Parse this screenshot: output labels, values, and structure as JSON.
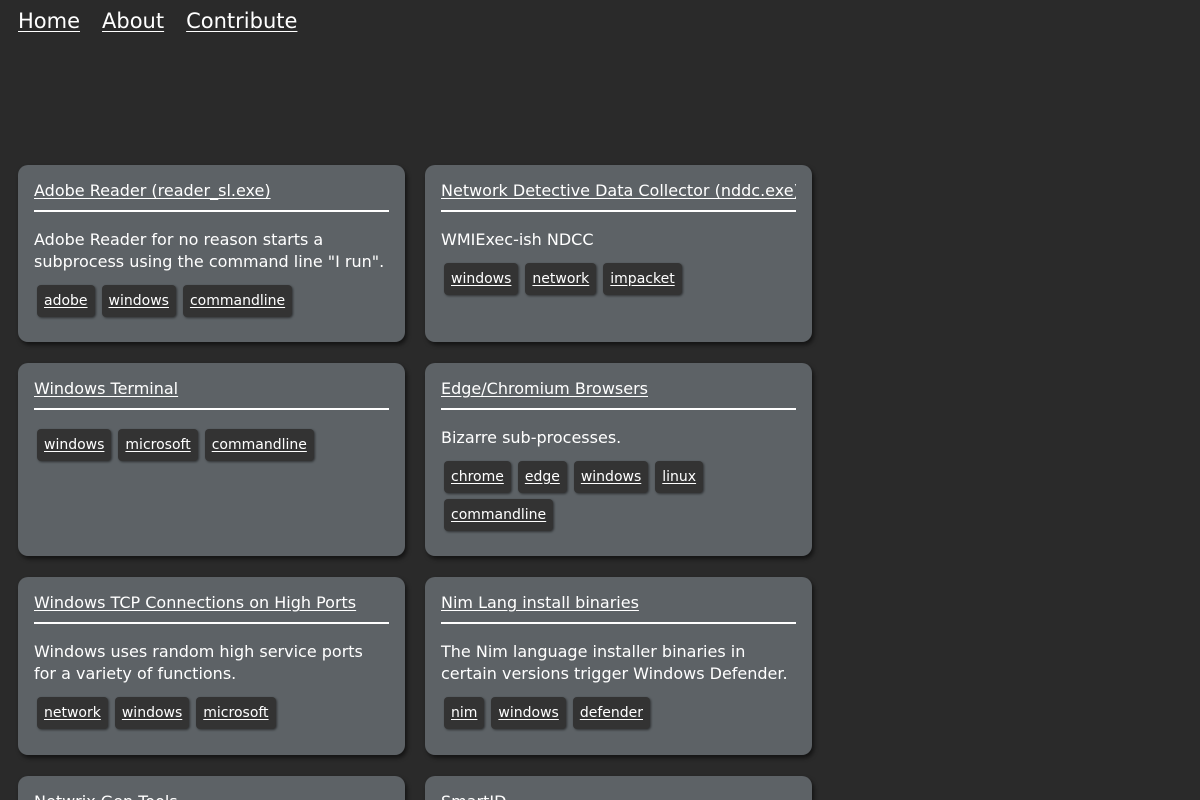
{
  "nav": {
    "home": "Home",
    "about": "About",
    "contribute": "Contribute"
  },
  "cards": [
    {
      "title": "Adobe Reader (reader_sl.exe)",
      "description": "Adobe Reader for no reason starts a subprocess using the command line \"I run\".",
      "tags": [
        "adobe",
        "windows",
        "commandline"
      ]
    },
    {
      "title": "Network Detective Data Collector (nddc.exe)",
      "description": "WMIExec-ish NDCC",
      "tags": [
        "windows",
        "network",
        "impacket"
      ]
    },
    {
      "title": "Windows Terminal",
      "description": "",
      "tags": [
        "windows",
        "microsoft",
        "commandline"
      ]
    },
    {
      "title": "Edge/Chromium Browsers",
      "description": "Bizarre sub-processes.",
      "tags": [
        "chrome",
        "edge",
        "windows",
        "linux",
        "commandline"
      ]
    },
    {
      "title": "Windows TCP Connections on High Ports",
      "description": "Windows uses random high service ports for a variety of functions.",
      "tags": [
        "network",
        "windows",
        "microsoft"
      ]
    },
    {
      "title": "Nim Lang install binaries",
      "description": "The Nim language installer binaries in certain versions trigger Windows Defender.",
      "tags": [
        "nim",
        "windows",
        "defender"
      ]
    },
    {
      "title": "Netwrix Gen Tools",
      "description": "",
      "tags": []
    },
    {
      "title": "SmartID",
      "description": "",
      "tags": []
    }
  ]
}
